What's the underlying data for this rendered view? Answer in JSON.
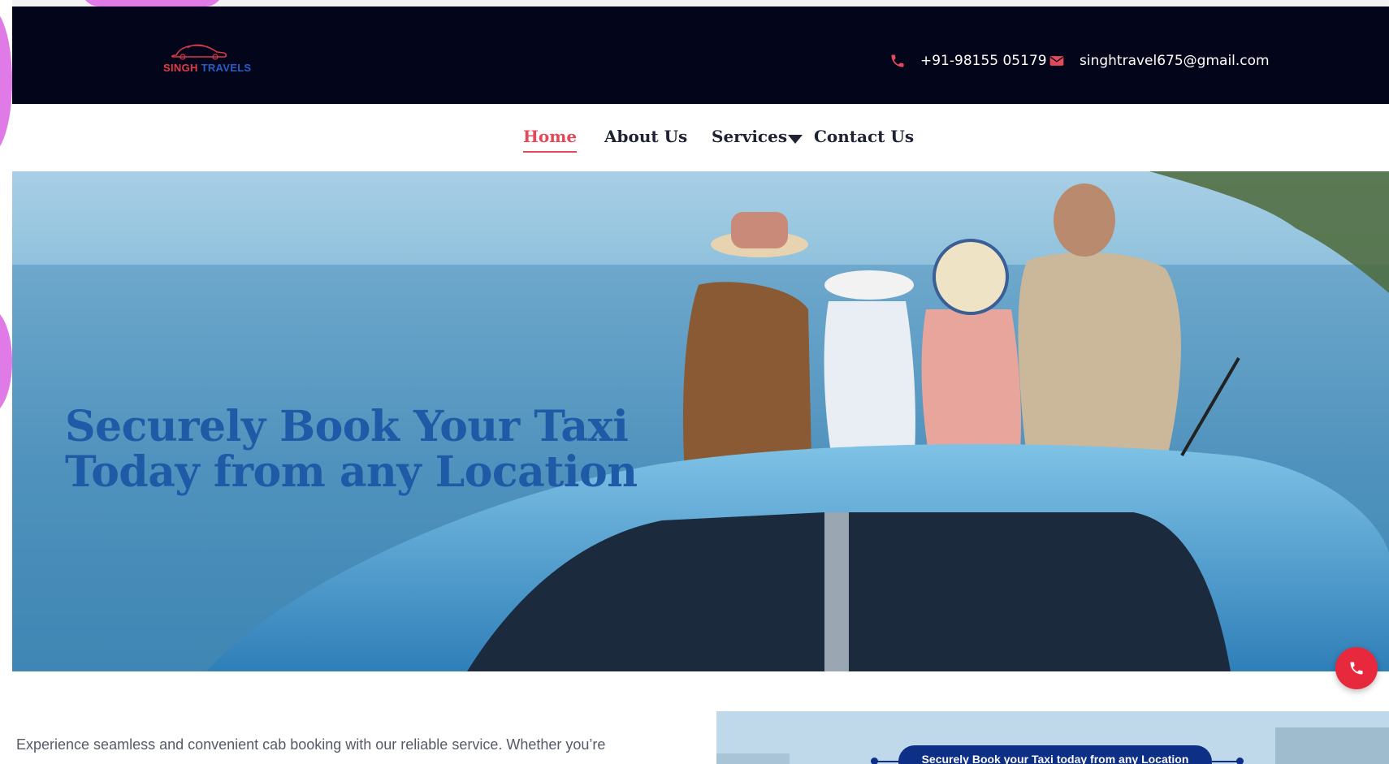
{
  "brand": {
    "logo_word1": "SINGH",
    "logo_word2": "TRAVELS"
  },
  "contact": {
    "phone": "+91-98155 05179",
    "email": "singhtravel675@gmail.com"
  },
  "nav": {
    "items": [
      {
        "label": "Home",
        "active": true
      },
      {
        "label": "About Us",
        "active": false
      },
      {
        "label": "Services",
        "active": false
      },
      {
        "label": "Contact Us",
        "active": false
      }
    ]
  },
  "hero": {
    "title_line1": "Securely Book Your Taxi",
    "title_line2": "Today from any Location"
  },
  "intro": {
    "text": "Experience seamless and convenient cab booking with our reliable service. Whether you’re"
  },
  "promo": {
    "pill_text": "Securely Book your Taxi today from any Location"
  },
  "icons": {
    "phone": "phone-icon",
    "email": "envelope-icon",
    "fab": "phone-icon"
  },
  "colors": {
    "topbar_bg": "#03061a",
    "accent": "#e24a59",
    "hero_title": "#1f5aa6",
    "fab": "#e8283d",
    "promo_pill": "#0e2f86"
  }
}
